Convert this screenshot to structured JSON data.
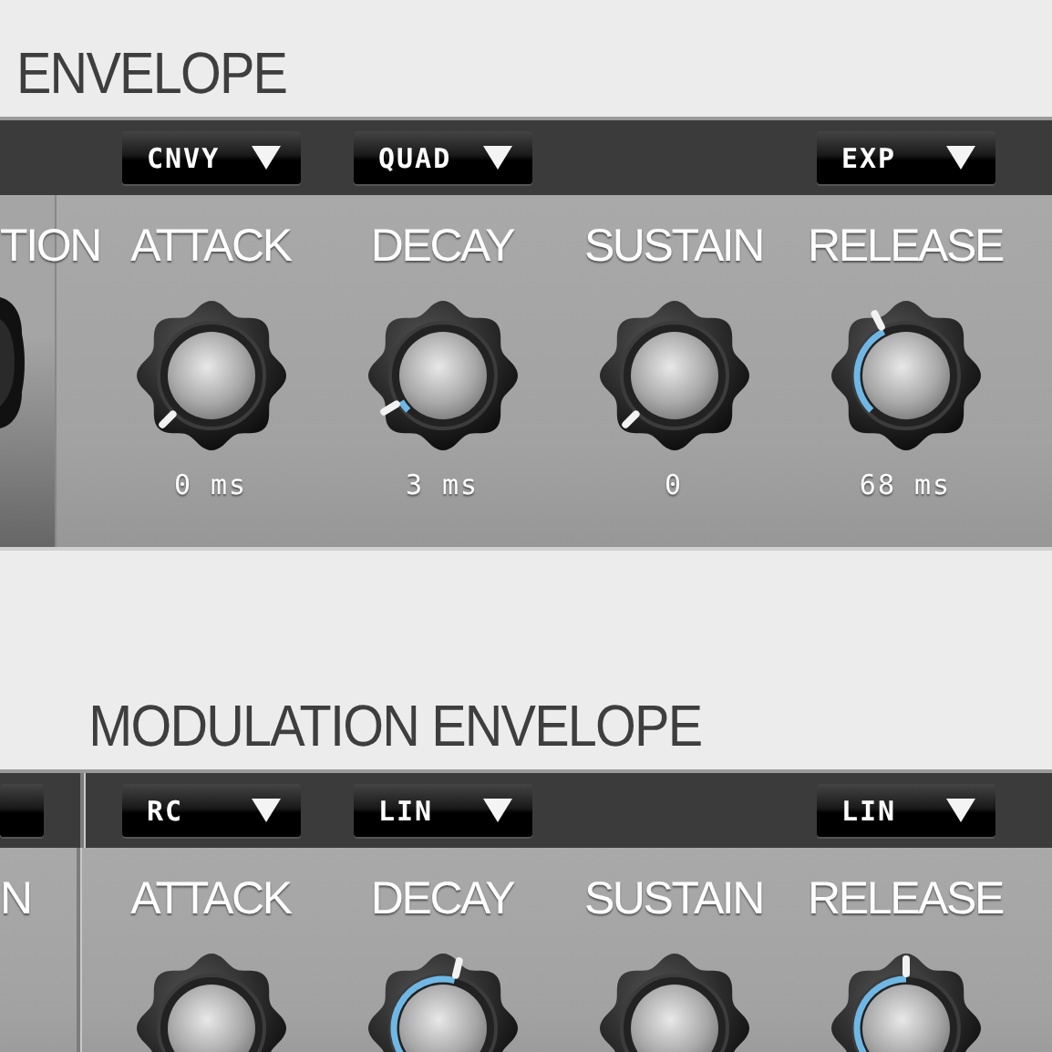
{
  "sections": [
    {
      "title": "ENVELOPE",
      "kind": "main",
      "left_label": "TION",
      "columns": [
        {
          "label": "ATTACK",
          "dropdown": "CNVY",
          "reading": "0 ms"
        },
        {
          "label": "DECAY",
          "dropdown": "QUAD",
          "reading": "3 ms"
        },
        {
          "label": "SUSTAIN",
          "reading": "0"
        },
        {
          "label": "RELEASE",
          "dropdown": "EXP",
          "reading": "68 ms"
        }
      ]
    },
    {
      "title": "MODULATION ENVELOPE",
      "kind": "modulation",
      "left_label": "N",
      "columns": [
        {
          "label": "ATTACK",
          "dropdown": "RC"
        },
        {
          "label": "DECAY",
          "dropdown": "LIN"
        },
        {
          "label": "SUSTAIN"
        },
        {
          "label": "RELEASE",
          "dropdown": "LIN"
        }
      ]
    }
  ]
}
